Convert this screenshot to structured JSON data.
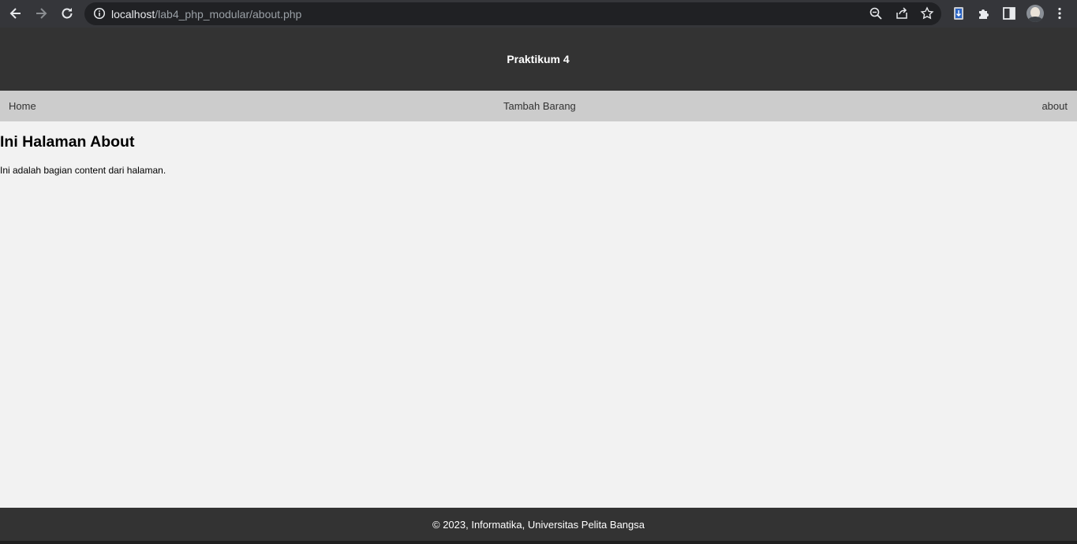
{
  "browser": {
    "url_host": "localhost",
    "url_path": "/lab4_php_modular/about.php",
    "icons": [
      "back-arrow-icon",
      "forward-arrow-icon",
      "reload-icon",
      "info-icon",
      "zoom-icon",
      "share-icon",
      "star-icon",
      "extension-badge-icon",
      "puzzle-icon",
      "side-panel-icon",
      "profile-avatar",
      "kebab-menu-icon"
    ]
  },
  "header": {
    "title": "Praktikum 4"
  },
  "nav": {
    "items": [
      {
        "label": "Home"
      },
      {
        "label": "Tambah Barang"
      },
      {
        "label": "about"
      }
    ]
  },
  "main": {
    "heading": "Ini Halaman About",
    "paragraph": "Ini adalah bagian content dari halaman."
  },
  "footer": {
    "text": "© 2023, Informatika, Universitas Pelita Bangsa"
  },
  "colors": {
    "chrome_bg": "#35363a",
    "omnibox_bg": "#202124",
    "header_bg": "#333333",
    "nav_bg": "#cccccc",
    "page_bg": "#f2f2f2"
  }
}
